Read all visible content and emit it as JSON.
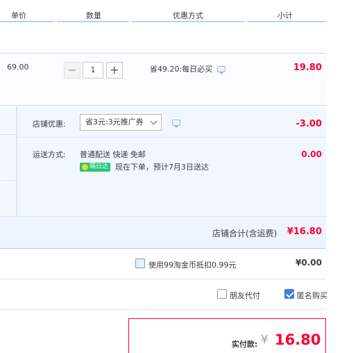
{
  "header": {
    "col_price": "单价",
    "col_qty": "数量",
    "col_promo": "优惠方式",
    "col_subtotal": "小计"
  },
  "item": {
    "unit_price": "69.00",
    "quantity": "1",
    "minus_symbol": "−",
    "plus_symbol": "+",
    "promo_text": "省49.20:每日必买",
    "subtotal": "19.80"
  },
  "shop": {
    "discount_label": "店铺优惠:",
    "discount_selected": "省3元:3元推广券",
    "discount_value": "-3.00",
    "shipping_label": "运送方式:",
    "shipping_method": "普通配送 快递 免邮",
    "shipping_fee": "0.00",
    "next_day_badge": "隔日达",
    "delivery_note": "现在下单，预计7月3日送达",
    "total_label": "店铺合计(含运费)",
    "total_value": "¥16.80"
  },
  "coins": {
    "label": "使用99淘金币抵扣0.99元",
    "value": "¥0.00",
    "checked": false
  },
  "options": {
    "friend_pay_label": "朋友代付",
    "friend_pay_checked": false,
    "anonymous_label": "匿名购买",
    "anonymous_checked": true
  },
  "payment": {
    "label": "实付款:",
    "currency": "¥",
    "amount": "16.80"
  },
  "colors": {
    "accent_red": "#ff0036",
    "row_blue": "#eef4fd",
    "border_blue": "#b2d1ff",
    "check_blue": "#3d7de0",
    "badge_green": "#1ec77b"
  }
}
